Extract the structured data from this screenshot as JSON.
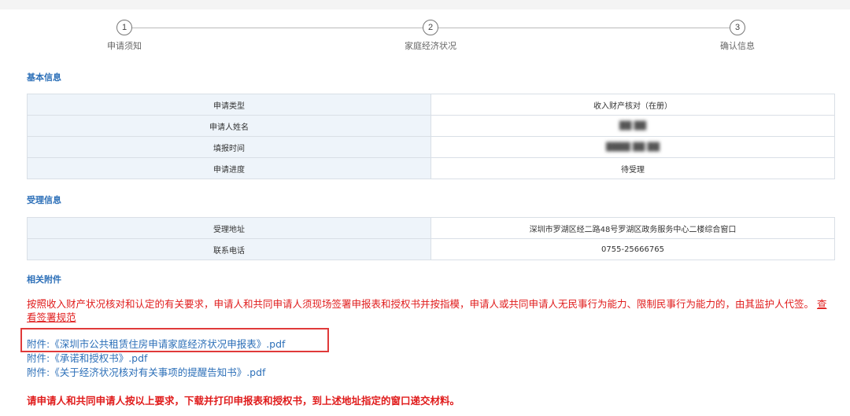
{
  "steps": [
    {
      "number": "1",
      "label": "申请须知"
    },
    {
      "number": "2",
      "label": "家庭经济状况"
    },
    {
      "number": "3",
      "label": "确认信息"
    }
  ],
  "basic_info": {
    "title": "基本信息",
    "rows": [
      {
        "label": "申请类型",
        "value": "收入财产核对（在册）"
      },
      {
        "label": "申请人姓名",
        "value": "██ ██"
      },
      {
        "label": "填报时间",
        "value": "████ ██ ██"
      },
      {
        "label": "申请进度",
        "value": "待受理"
      }
    ]
  },
  "accept_info": {
    "title": "受理信息",
    "rows": [
      {
        "label": "受理地址",
        "value": "深圳市罗湖区经二路48号罗湖区政务服务中心二楼综合窗口"
      },
      {
        "label": "联系电话",
        "value": "0755-25666765"
      }
    ]
  },
  "attachments_section": {
    "title": "相关附件",
    "notice": "按照收入财产状况核对和认定的有关要求，申请人和共同申请人须现场签署申报表和授权书并按指模，申请人或共同申请人无民事行为能力、限制民事行为能力的，由其监护人代签。",
    "notice_link": "查看签署规范",
    "files": [
      "附件:《深圳市公共租赁住房申请家庭经济状况申报表》.pdf",
      "附件:《承诺和授权书》.pdf",
      "附件:《关于经济状况核对有关事项的提醒告知书》.pdf"
    ],
    "final_note": "请申请人和共同申请人按以上要求，下载并打印申报表和授权书，到上述地址指定的窗口递交材料。"
  },
  "colors": {
    "accent_blue": "#2c6fb8",
    "warning_red": "#e01c1c",
    "highlight_box": "#e03a3a",
    "table_key_bg": "#eef4fa"
  }
}
